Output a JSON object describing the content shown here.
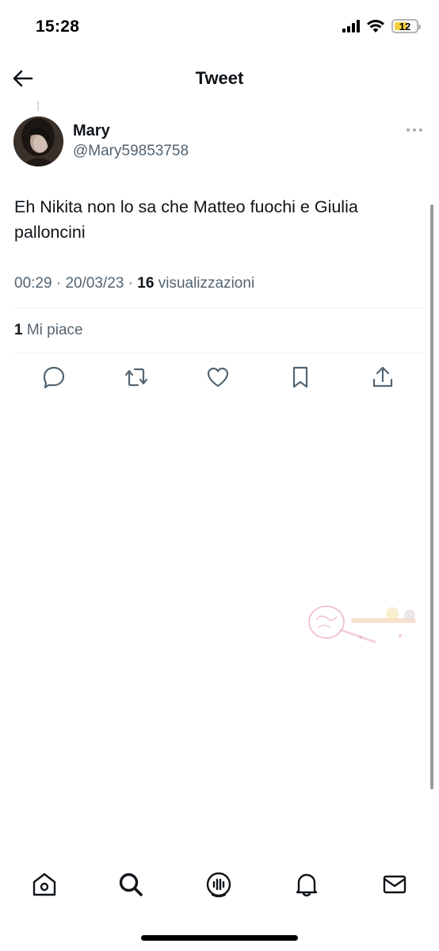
{
  "status_bar": {
    "time": "15:28",
    "battery": "12",
    "icons": [
      "signal-icon",
      "wifi-icon",
      "battery-icon"
    ]
  },
  "header": {
    "title": "Tweet",
    "back_icon": "arrow-left-icon"
  },
  "tweet": {
    "author_name": "Mary",
    "author_handle": "@Mary59853758",
    "text": "Eh Nikita non lo sa che Matteo fuochi e Giulia palloncini",
    "time": "00:29",
    "date": "20/03/23",
    "views_count": "16",
    "views_label": "visualizzazioni",
    "likes_count": "1",
    "likes_label": "Mi piace"
  },
  "actions": [
    "reply-icon",
    "retweet-icon",
    "like-icon",
    "bookmark-icon",
    "share-icon"
  ],
  "bottom_nav": [
    "home-icon",
    "search-icon",
    "spaces-icon",
    "notifications-icon",
    "messages-icon"
  ],
  "colors": {
    "text": "#0f1419",
    "secondary": "#536471",
    "divider": "#eff3f4",
    "battery": "#f5cf3f"
  }
}
